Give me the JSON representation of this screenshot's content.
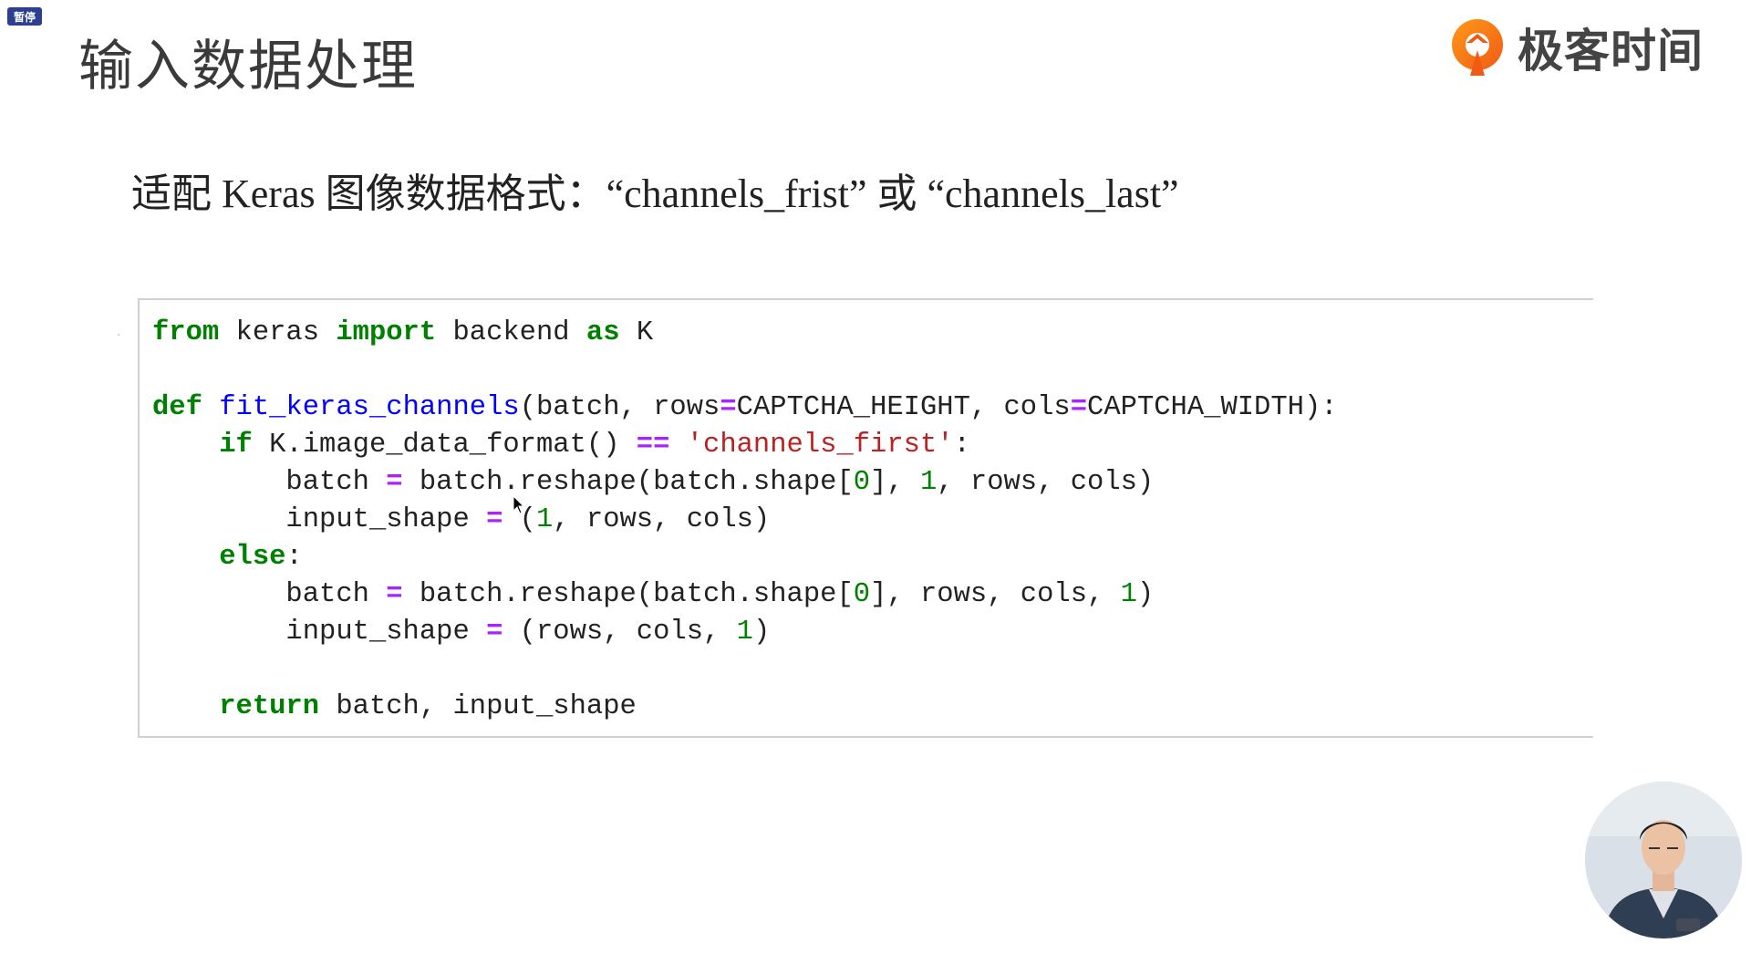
{
  "badge": {
    "label": "暂停"
  },
  "page_title": "输入数据处理",
  "logo": {
    "text": "极客时间"
  },
  "subtitle": "适配 Keras 图像数据格式：“channels_frist” 或 “channels_last”",
  "code": {
    "lines": [
      [
        {
          "t": "from",
          "c": "kw"
        },
        {
          "t": " keras "
        },
        {
          "t": "import",
          "c": "kw"
        },
        {
          "t": " backend "
        },
        {
          "t": "as",
          "c": "kw"
        },
        {
          "t": " K"
        }
      ],
      [],
      [
        {
          "t": "def",
          "c": "kw"
        },
        {
          "t": " "
        },
        {
          "t": "fit_keras_channels",
          "c": "fn"
        },
        {
          "t": "(batch, rows"
        },
        {
          "t": "=",
          "c": "op"
        },
        {
          "t": "CAPTCHA_HEIGHT, cols"
        },
        {
          "t": "=",
          "c": "op"
        },
        {
          "t": "CAPTCHA_WIDTH):"
        }
      ],
      [
        {
          "t": "    "
        },
        {
          "t": "if",
          "c": "kw"
        },
        {
          "t": " K.image_data_format() "
        },
        {
          "t": "==",
          "c": "op"
        },
        {
          "t": " "
        },
        {
          "t": "'channels_first'",
          "c": "str"
        },
        {
          "t": ":"
        }
      ],
      [
        {
          "t": "        batch "
        },
        {
          "t": "=",
          "c": "op"
        },
        {
          "t": " batch.reshape(batch.shape["
        },
        {
          "t": "0",
          "c": "num"
        },
        {
          "t": "], "
        },
        {
          "t": "1",
          "c": "num"
        },
        {
          "t": ", rows, cols)"
        }
      ],
      [
        {
          "t": "        input_shape "
        },
        {
          "t": "=",
          "c": "op"
        },
        {
          "t": " ("
        },
        {
          "t": "1",
          "c": "num"
        },
        {
          "t": ", rows, cols)"
        }
      ],
      [
        {
          "t": "    "
        },
        {
          "t": "else",
          "c": "kw"
        },
        {
          "t": ":"
        }
      ],
      [
        {
          "t": "        batch "
        },
        {
          "t": "=",
          "c": "op"
        },
        {
          "t": " batch.reshape(batch.shape["
        },
        {
          "t": "0",
          "c": "num"
        },
        {
          "t": "], rows, cols, "
        },
        {
          "t": "1",
          "c": "num"
        },
        {
          "t": ")"
        }
      ],
      [
        {
          "t": "        input_shape "
        },
        {
          "t": "=",
          "c": "op"
        },
        {
          "t": " (rows, cols, "
        },
        {
          "t": "1",
          "c": "num"
        },
        {
          "t": ")"
        }
      ],
      [],
      [
        {
          "t": "    "
        },
        {
          "t": "return",
          "c": "kw"
        },
        {
          "t": " batch, input_shape"
        }
      ]
    ]
  },
  "icons": [
    "pause-badge",
    "geektime-logo-icon",
    "mouse-cursor-icon",
    "presenter-webcam"
  ]
}
